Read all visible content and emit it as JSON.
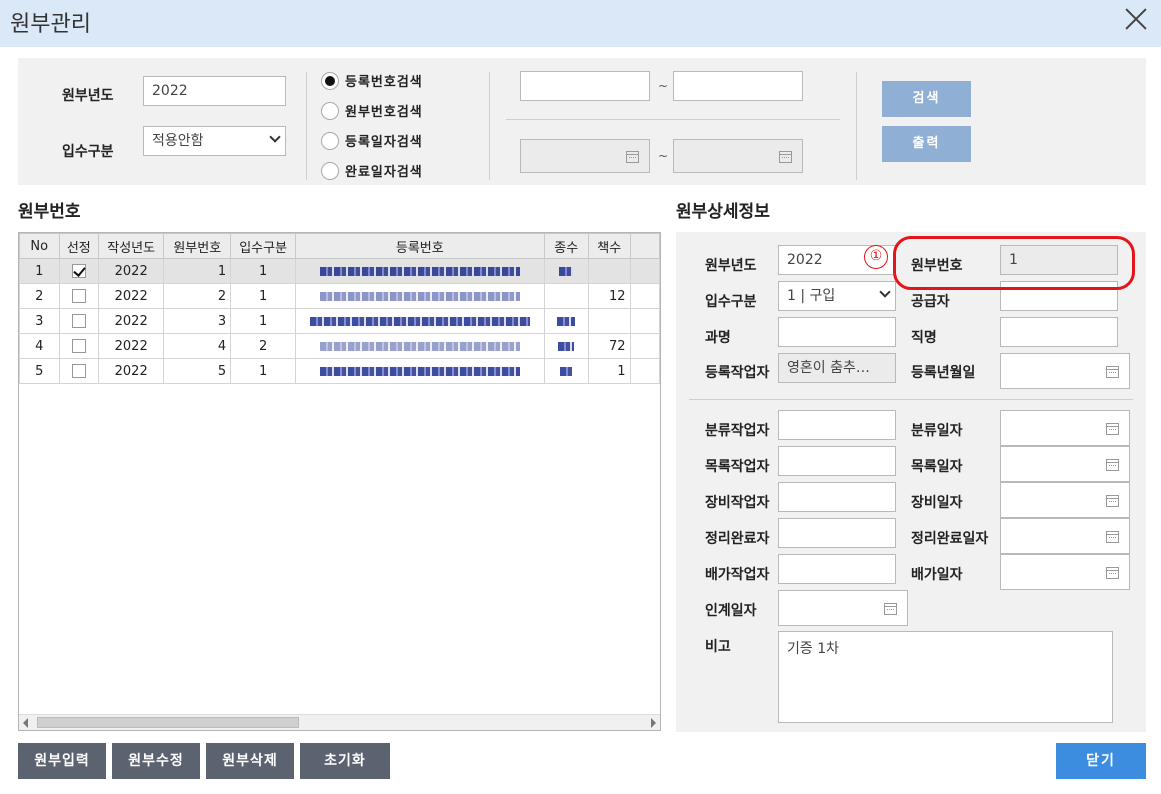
{
  "window": {
    "title": "원부관리"
  },
  "search": {
    "year_label": "원부년도",
    "year_value": "2022",
    "intake_label": "입수구분",
    "intake_value": "적용안함",
    "radios": [
      {
        "label": "등록번호검색",
        "selected": true
      },
      {
        "label": "원부번호검색",
        "selected": false
      },
      {
        "label": "등록일자검색",
        "selected": false
      },
      {
        "label": "완료일자검색",
        "selected": false
      }
    ],
    "tilde": "~",
    "search_button": "검색",
    "print_button": "출력"
  },
  "list": {
    "section_title": "원부번호",
    "columns": [
      "No",
      "선정",
      "작성년도",
      "원부번호",
      "입수구분",
      "등록번호",
      "종수",
      "책수"
    ],
    "rows": [
      {
        "no": "1",
        "checked": true,
        "year": "2022",
        "num": "1",
        "intake": "1",
        "copies": ""
      },
      {
        "no": "2",
        "checked": false,
        "year": "2022",
        "num": "2",
        "intake": "1",
        "copies": "12"
      },
      {
        "no": "3",
        "checked": false,
        "year": "2022",
        "num": "3",
        "intake": "1",
        "copies": ""
      },
      {
        "no": "4",
        "checked": false,
        "year": "2022",
        "num": "4",
        "intake": "2",
        "copies": "72"
      },
      {
        "no": "5",
        "checked": false,
        "year": "2022",
        "num": "5",
        "intake": "1",
        "copies": "1"
      }
    ]
  },
  "detail": {
    "section_title": "원부상세정보",
    "year_label": "원부년도",
    "year_value": "2022",
    "num_label": "원부번호",
    "num_value": "1",
    "intake_label": "입수구분",
    "intake_value": "1 | 구입",
    "supplier_label": "공급자",
    "course_label": "과명",
    "position_label": "직명",
    "reg_worker_label": "등록작업자",
    "reg_worker_value": "영혼이 춤추…",
    "reg_date_label": "등록년월일",
    "class_worker_label": "분류작업자",
    "class_date_label": "분류일자",
    "catalog_worker_label": "목록작업자",
    "catalog_date_label": "목록일자",
    "equip_worker_label": "장비작업자",
    "equip_date_label": "장비일자",
    "done_worker_label": "정리완료자",
    "done_date_label": "정리완료일자",
    "shelf_worker_label": "배가작업자",
    "shelf_date_label": "배가일자",
    "transfer_date_label": "인계일자",
    "remark_label": "비고",
    "remark_value": "기증 1차"
  },
  "actions": {
    "input": "원부입력",
    "edit": "원부수정",
    "delete": "원부삭제",
    "reset": "초기화",
    "close": "닫기"
  },
  "annotation": {
    "marker": "①",
    "color": "#e3151a"
  }
}
